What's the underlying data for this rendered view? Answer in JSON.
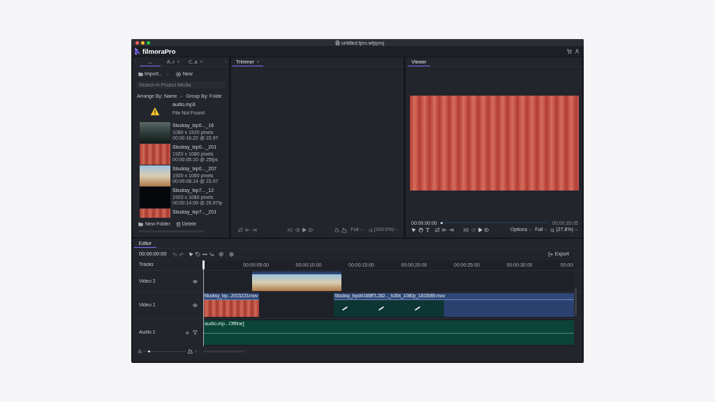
{
  "window": {
    "title": "untitled.fpro.wfpproj"
  },
  "app_bar": {
    "logo": "filmoraPro"
  },
  "media_panel": {
    "tabs": [
      {
        "label": "...",
        "selected": true,
        "closable": false
      },
      {
        "label": "A..r",
        "selected": false,
        "closable": true
      },
      {
        "label": "C..a",
        "selected": false,
        "closable": true
      }
    ],
    "import_button": "Import...",
    "new_button": "New",
    "search": {
      "placeholder": "Search in Project Media"
    },
    "arrange": "Arrange By: Name",
    "group": "Group By: Folde",
    "items": [
      {
        "kind": "missing",
        "name": "audio.mp3",
        "details": [
          "File Not Found"
        ]
      },
      {
        "kind": "video",
        "name": "Stocksy_txp0..._16",
        "details": [
          "1080 x 1920 pixels",
          "00:00:16:22 @ 23.97"
        ]
      },
      {
        "kind": "video",
        "name": "Stocksy_txp0..._201",
        "details": [
          "1920 x 1080 pixels",
          "00:00:05:10 @ 25fps"
        ]
      },
      {
        "kind": "video",
        "name": "Stocksy_txp0..._207",
        "details": [
          "1920 x 1080 pixels",
          "00:00:08:14 @ 23.97"
        ]
      },
      {
        "kind": "video",
        "name": "Stocksy_txp7..._12",
        "details": [
          "1920 x 1080 pixels",
          "00:00:14:09 @ 29.97fp"
        ]
      },
      {
        "kind": "video",
        "name": "Stocksy_txp7..._201"
      }
    ],
    "new_folder_button": "New Folder",
    "delete_button": "Delete"
  },
  "trimmer": {
    "tab": {
      "label": "Trimmer",
      "selected": true,
      "closable": true
    },
    "disabled": true,
    "quality": "Full",
    "zoom": "(100.0%)"
  },
  "viewer": {
    "tab": {
      "label": "Viewer",
      "selected": true,
      "closable": false
    },
    "timecode": "00:00:00:00",
    "duration": "00:00:35:05",
    "scrubber": {
      "level": 0
    },
    "options": "Options",
    "quality": "Full",
    "zoom": "(27.8%)"
  },
  "editor": {
    "tab": {
      "label": "Editor",
      "selected": true,
      "closable": false
    },
    "timecode": "00:00:00:00",
    "export": "Export",
    "tracks_label": "Tracks",
    "ruler": [
      "00:00:05:00",
      "00:00:10:00",
      "00:00:15:00",
      "00:00:20:00",
      "00:00:25:00",
      "00:00:30:00",
      "00:00:"
    ],
    "tracks": [
      {
        "name": "Video 2",
        "kind": "video",
        "clips": [
          {
            "kind": "video"
          }
        ]
      },
      {
        "name": "Video 1",
        "kind": "video",
        "clips": [
          {
            "kind": "video",
            "title": "Stocksy_txp...2015223.mov"
          },
          {
            "kind": "loading",
            "title": "Stocksy_txpd4166ff7L282..._h264_1080p_1815089.mov"
          }
        ]
      },
      {
        "name": "Audio 1",
        "kind": "audio",
        "clips": [
          {
            "kind": "offline",
            "title": "audio.mp...Offline]"
          }
        ]
      }
    ],
    "zoom_slider": {
      "level": 0.12
    }
  }
}
